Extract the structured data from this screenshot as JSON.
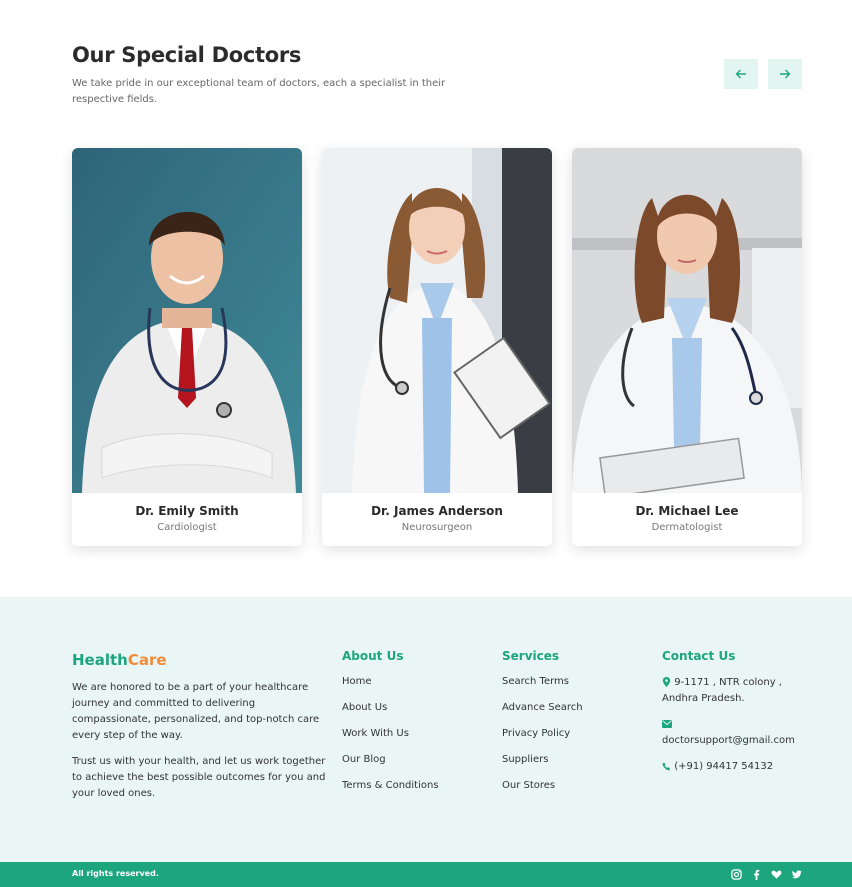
{
  "section": {
    "title": "Our Special Doctors",
    "subtitle": "We take pride in our exceptional team of doctors, each a specialist in their respective fields."
  },
  "nav": {
    "prev_icon": "arrow-left-icon",
    "next_icon": "arrow-right-icon"
  },
  "doctors": [
    {
      "name": "Dr. Emily Smith",
      "specialty": "Cardiologist"
    },
    {
      "name": "Dr. James Anderson",
      "specialty": "Neurosurgeon"
    },
    {
      "name": "Dr. Michael Lee",
      "specialty": "Dermatologist"
    }
  ],
  "footer": {
    "brand": {
      "part1": "Health",
      "part2": "Care"
    },
    "about_p1": "We are honored to be a part of your healthcare journey and committed to delivering compassionate, personalized, and top-notch care every step of the way.",
    "about_p2": "Trust us with your health, and let us work together to achieve the best possible outcomes for you and your loved ones.",
    "about_us": {
      "title": "About Us",
      "links": [
        "Home",
        "About Us",
        "Work With Us",
        "Our Blog",
        "Terms & Conditions"
      ]
    },
    "services": {
      "title": "Services",
      "links": [
        "Search Terms",
        "Advance Search",
        "Privacy Policy",
        "Suppliers",
        "Our Stores"
      ]
    },
    "contact": {
      "title": "Contact Us",
      "address_line1": "9-1171 , NTR colony ,",
      "address_line2": "Andhra Pradesh.",
      "email": "doctorsupport@gmail.com",
      "phone": "(+91) 94417 54132"
    }
  },
  "bottom": {
    "rights": "All rights reserved.",
    "social": [
      "instagram-icon",
      "facebook-icon",
      "heart-icon",
      "twitter-icon"
    ]
  },
  "colors": {
    "accent": "#1da67d",
    "brand_orange": "#f28b36",
    "footer_bg": "#e9f6f5",
    "nav_bg": "#e3f5f1"
  }
}
